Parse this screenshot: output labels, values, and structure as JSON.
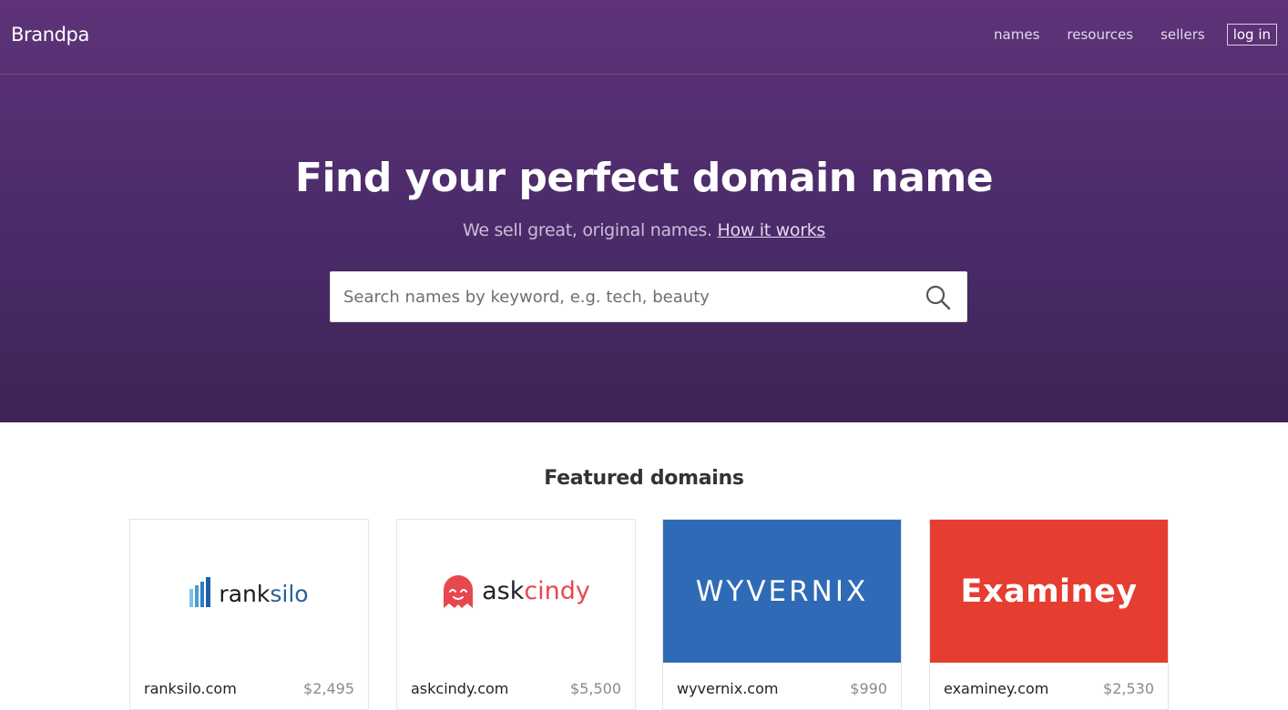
{
  "header": {
    "logo": "Brandpa",
    "nav": [
      "names",
      "resources",
      "sellers"
    ],
    "login": "log in"
  },
  "hero": {
    "title": "Find your perfect domain name",
    "subtitle": "We sell great, original names.",
    "subtitle_link": "How it works",
    "search_placeholder": "Search names by keyword, e.g. tech, beauty"
  },
  "featured": {
    "title": "Featured domains",
    "cards": [
      {
        "logo_parts": [
          "rank",
          "silo"
        ],
        "domain": "ranksilo.com",
        "price": "$2,495",
        "logo_colors": [
          "#1a1a1a",
          "#2a5f9e"
        ]
      },
      {
        "logo_parts": [
          "ask",
          "cindy"
        ],
        "domain": "askcindy.com",
        "price": "$5,500",
        "logo_colors": [
          "#222222",
          "#e8474f"
        ]
      },
      {
        "logo_text": "WYVERNIX",
        "domain": "wyvernix.com",
        "price": "$990",
        "background": "#2f6ab6"
      },
      {
        "logo_text": "Examiney",
        "domain": "examiney.com",
        "price": "$2,530",
        "background": "#e63d31"
      }
    ]
  }
}
